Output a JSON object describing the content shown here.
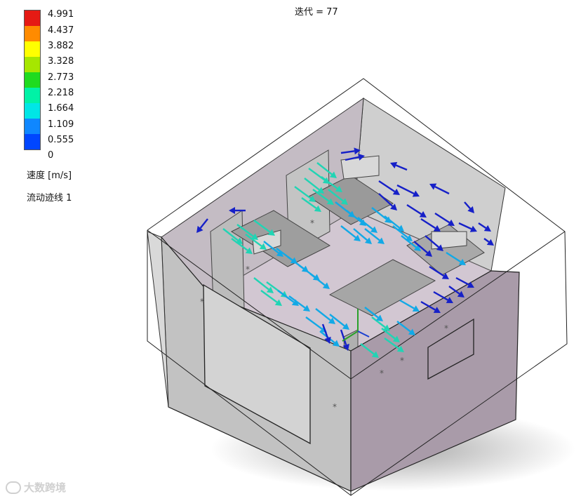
{
  "view": {
    "iteration_label": "迭代 = 77"
  },
  "legend": {
    "ticks": [
      "4.991",
      "4.437",
      "3.882",
      "3.328",
      "2.773",
      "2.218",
      "1.664",
      "1.109",
      "0.555",
      "0"
    ],
    "colors": [
      "#e51a14",
      "#ff8b00",
      "#ffff00",
      "#a6e600",
      "#1fdb1f",
      "#00f2a6",
      "#00e6e6",
      "#0f87ff",
      "#0046ff",
      "#0000d6"
    ],
    "quantity": "速度 [m/s]",
    "trace_name": "流动迹线 1"
  },
  "watermark": {
    "text": "大数跨境"
  },
  "colors": {
    "wall_gray": "#b8b8b8",
    "wall_pink": "#a89aa8",
    "floor": "#c9bfc9",
    "edge": "#222222",
    "slow_arrow": "#1620c8",
    "fast_arrow": "#21d4b4"
  }
}
